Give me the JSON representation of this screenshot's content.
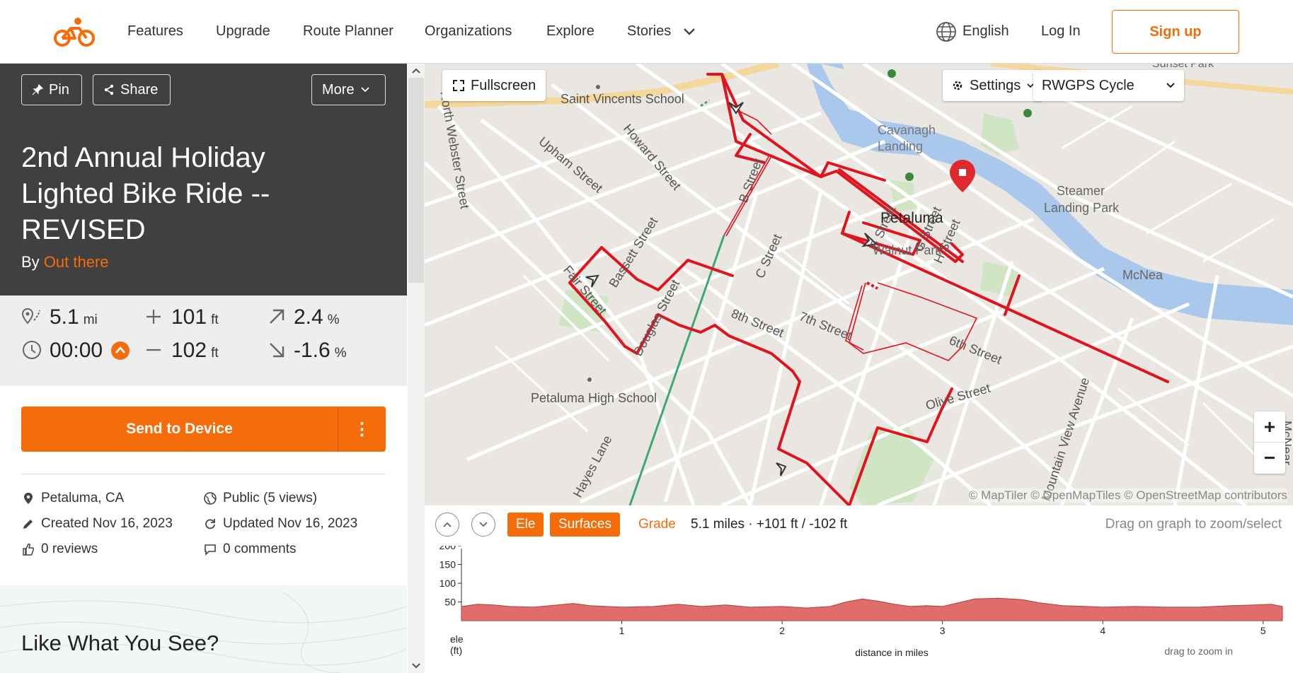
{
  "nav": {
    "items": [
      "Features",
      "Upgrade",
      "Route Planner",
      "Organizations",
      "Explore",
      "Stories"
    ],
    "language": "English",
    "login": "Log In",
    "signup": "Sign up"
  },
  "route": {
    "pin": "Pin",
    "share": "Share",
    "more": "More",
    "title": "2nd Annual Holiday Lighted Bike Ride -- REVISED",
    "by": "By",
    "author": "Out there"
  },
  "stats": {
    "distance": "5.1",
    "distance_unit": "mi",
    "ascent": "101",
    "ascent_unit": "ft",
    "max_grade": "2.4",
    "max_grade_unit": "%",
    "time": "00:00",
    "descent": "102",
    "descent_unit": "ft",
    "min_grade": "-1.6",
    "min_grade_unit": "%"
  },
  "actions": {
    "send": "Send to Device",
    "more_glyph": "⋮"
  },
  "meta": {
    "location": "Petaluma, CA",
    "visibility": "Public (5 views)",
    "created": "Created Nov 16, 2023",
    "updated": "Updated Nov 16, 2023",
    "reviews": "0 reviews",
    "comments": "0 comments"
  },
  "promo": {
    "title": "Like What You See?"
  },
  "map": {
    "fullscreen": "Fullscreen",
    "settings": "Settings",
    "layer": "RWGPS Cycle",
    "attribution": "© MapTiler © OpenMapTiles © OpenStreetMap contributors",
    "labels": {
      "saint_vincents": "Saint Vincents School",
      "cavanagh": "Cavanagh",
      "landing": "Landing",
      "steamer": "Steamer",
      "landing_park": "Landing Park",
      "sunset_park": "Sunset Park",
      "petaluma": "Petaluma",
      "walnut_park": "Walnut Park",
      "north_webster": "North Webster Street",
      "upham": "Upham Street",
      "howard": "Howard Street",
      "bassett": "Bassett Street",
      "fair": "Fair Street",
      "douglas": "Douglas Street",
      "b_street": "B Street",
      "c_street": "C Street",
      "f_street": "F Street",
      "g_street": "G Street",
      "h_street": "H Street",
      "eighth": "8th Street",
      "seventh": "7th Street",
      "sixth": "6th Street",
      "olive": "Olive Street",
      "high_school": "Petaluma High School",
      "hayes": "Hayes Lane",
      "mountain_view": "Mountain View Avenue",
      "mcnear": "McNea",
      "mcnear_v": "McNear"
    }
  },
  "elevation": {
    "tabs": [
      "Ele",
      "Surfaces"
    ],
    "grade": "Grade",
    "summary": "5.1 miles · +101 ft / -102 ft",
    "hint": "Drag on graph to zoom/select",
    "drag_hint": "drag to zoom in",
    "ele_label": "ele",
    "ft_label": "(ft)"
  },
  "chart_data": {
    "type": "area",
    "xlabel": "distance in miles",
    "ylabel": "ele (ft)",
    "xlim": [
      0,
      5.12
    ],
    "ylim": [
      0,
      200
    ],
    "x_ticks": [
      1,
      2,
      3,
      4,
      5
    ],
    "y_ticks": [
      50,
      100,
      150,
      200
    ],
    "color": "#d9534f",
    "x": [
      0,
      0.1,
      0.2,
      0.3,
      0.45,
      0.6,
      0.7,
      0.8,
      1.0,
      1.2,
      1.35,
      1.5,
      1.65,
      1.8,
      2.0,
      2.15,
      2.3,
      2.4,
      2.5,
      2.6,
      2.7,
      2.8,
      2.9,
      3.0,
      3.1,
      3.2,
      3.35,
      3.5,
      3.6,
      3.75,
      3.9,
      4.0,
      4.2,
      4.4,
      4.6,
      4.8,
      4.95,
      5.05,
      5.12
    ],
    "y": [
      38,
      44,
      42,
      38,
      36,
      42,
      46,
      40,
      36,
      38,
      44,
      38,
      42,
      36,
      38,
      34,
      38,
      50,
      58,
      52,
      44,
      38,
      40,
      38,
      48,
      58,
      60,
      56,
      48,
      40,
      38,
      36,
      38,
      36,
      36,
      40,
      42,
      44,
      38
    ]
  }
}
